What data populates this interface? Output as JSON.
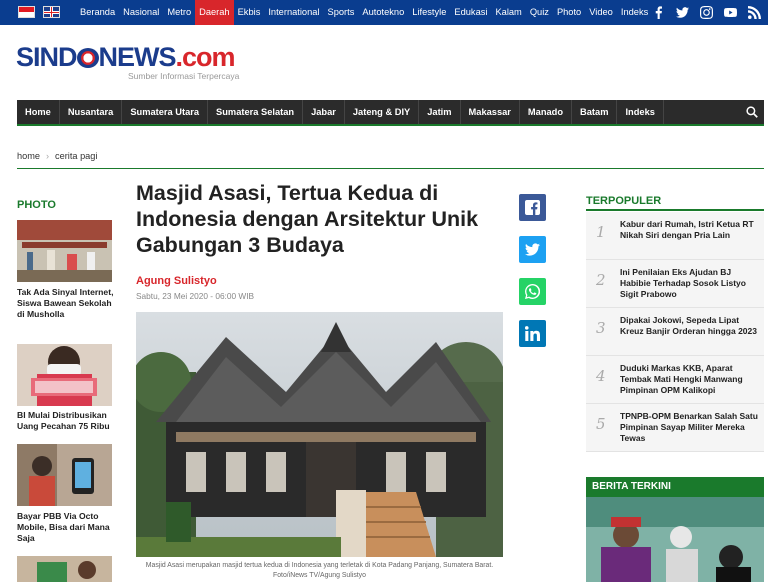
{
  "topnav": [
    "Beranda",
    "Nasional",
    "Metro",
    "Daerah",
    "Ekbis",
    "International",
    "Sports",
    "Autotekno",
    "Lifestyle",
    "Edukasi",
    "Kalam",
    "Quiz",
    "Photo",
    "Video",
    "Indeks"
  ],
  "logo": {
    "part1": "SIND",
    "part2": "NEWS",
    "part3": ".com",
    "tagline": "Sumber Informasi Terpercaya"
  },
  "mainnav": [
    "Home",
    "Nusantara",
    "Sumatera Utara",
    "Sumatera Selatan",
    "Jabar",
    "Jateng & DIY",
    "Jatim",
    "Makassar",
    "Manado",
    "Batam",
    "Indeks"
  ],
  "breadcrumb": {
    "home": "home",
    "sep": "›",
    "current": "cerita pagi"
  },
  "photo": {
    "title": "PHOTO",
    "items": [
      {
        "caption": "Tak Ada Sinyal Internet, Siswa Bawean Sekolah di Musholla"
      },
      {
        "caption": "BI Mulai Distribusikan Uang Pecahan 75 Ribu"
      },
      {
        "caption": "Bayar PBB Via Octo Mobile, Bisa dari Mana Saja"
      }
    ]
  },
  "article": {
    "title": "Masjid Asasi, Tertua Kedua di Indonesia dengan Arsitektur Unik Gabungan 3 Budaya",
    "author": "Agung Sulistyo",
    "date": "Sabtu, 23 Mei 2020 - 06:00 WIB",
    "caption": "Masjid Asasi merupakan masjid tertua kedua di Indonesia yang terletak di Kota Padang Panjang, Sumatera Barat. Foto/iNews TV/Agung Sulistyo"
  },
  "terpopuler": {
    "title": "TERPOPULER",
    "items": [
      {
        "num": "1",
        "text": "Kabur dari Rumah, Istri Ketua RT Nikah Siri dengan Pria Lain"
      },
      {
        "num": "2",
        "text": "Ini Penilaian Eks Ajudan BJ Habibie Terhadap Sosok Listyo Sigit Prabowo"
      },
      {
        "num": "3",
        "text": "Dipakai Jokowi, Sepeda Lipat Kreuz Banjir Orderan hingga 2023"
      },
      {
        "num": "4",
        "text": "Duduki Markas KKB, Aparat Tembak Mati Hengki Manwang Pimpinan OPM Kalikopi"
      },
      {
        "num": "5",
        "text": "TPNPB-OPM Benarkan Salah Satu Pimpinan Sayap Militer Mereka Tewas"
      }
    ]
  },
  "berita_terkini": {
    "title": "BERITA TERKINI"
  },
  "colors": {
    "topbar": "#0a3d8f",
    "accent_red": "#d8262b",
    "accent_green": "#1a7a2c",
    "facebook": "#3b5998",
    "twitter": "#1da1f2",
    "whatsapp": "#25d366",
    "linkedin": "#0077b5"
  }
}
